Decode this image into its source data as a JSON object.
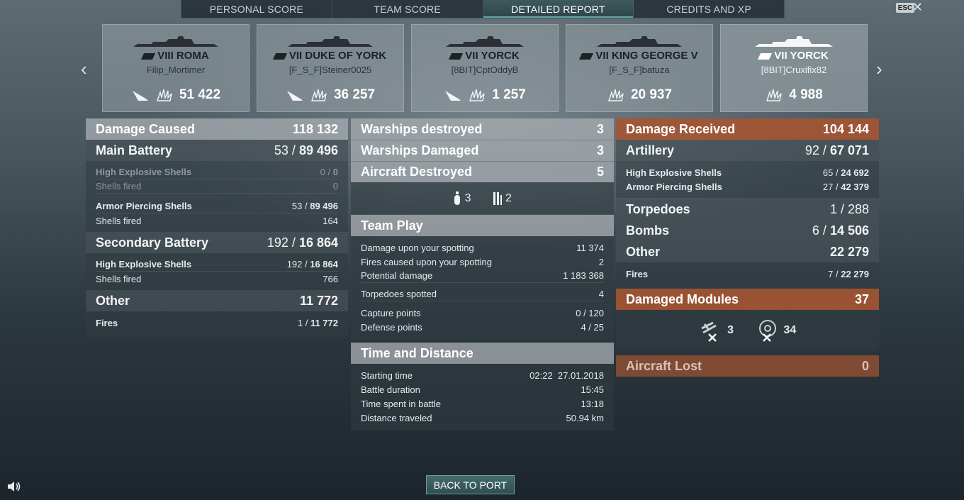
{
  "tabs": [
    "PERSONAL SCORE",
    "TEAM SCORE",
    "DETAILED REPORT",
    "CREDITS AND XP"
  ],
  "esc_label": "ESC",
  "close_glyph": "✕",
  "ships": [
    {
      "tier_name": "VIII ROMA",
      "player": "Filip_Mortimer",
      "score": "51 422"
    },
    {
      "tier_name": "VII DUKE OF YORK",
      "player": "[F_S_F]Steiner0025",
      "score": "36 257"
    },
    {
      "tier_name": "VII YORCK",
      "player": "[8BIT]CptOddyB",
      "score": "1 257"
    },
    {
      "tier_name": "VII KING GEORGE V",
      "player": "[F_S_F]batuza",
      "score": "20 937"
    },
    {
      "tier_name": "VII YORCK",
      "player": "[8BIT]Cruxifix82",
      "score": "4 988"
    }
  ],
  "left": {
    "damage_caused": {
      "label": "Damage Caused",
      "value": "118 132"
    },
    "main_battery": {
      "label": "Main Battery",
      "hits": "53 /",
      "value": "89 496"
    },
    "he_label": "High Explosive Shells",
    "he_hits": "0 /",
    "he_value": "0",
    "he_fired_label": "Shells fired",
    "he_fired": "0",
    "ap_label": "Armor Piercing Shells",
    "ap_hits": "53 /",
    "ap_value": "89 496",
    "ap_fired_label": "Shells fired",
    "ap_fired": "164",
    "secondary": {
      "label": "Secondary Battery",
      "hits": "192 /",
      "value": "16 864"
    },
    "sec_he_label": "High Explosive Shells",
    "sec_he_hits": "192 /",
    "sec_he_value": "16 864",
    "sec_fired_label": "Shells fired",
    "sec_fired": "766",
    "other": {
      "label": "Other",
      "value": "11 772"
    },
    "fires_label": "Fires",
    "fires_hits": "1 /",
    "fires_value": "11 772"
  },
  "middle": {
    "destroyed": {
      "label": "Warships destroyed",
      "value": "3"
    },
    "damaged": {
      "label": "Warships Damaged",
      "value": "3"
    },
    "aircraft": {
      "label": "Aircraft Destroyed",
      "value": "5"
    },
    "icons": {
      "a": "3",
      "b": "2"
    },
    "team_play": "Team Play",
    "tp": [
      {
        "label": "Damage upon your spotting",
        "value": "11 374"
      },
      {
        "label": "Fires caused upon your spotting",
        "value": "2"
      },
      {
        "label": "Potential damage",
        "value": "1 183 368"
      },
      {
        "label": "Torpedoes spotted",
        "value": "4"
      },
      {
        "label": "Capture points",
        "value": "0 / 120"
      },
      {
        "label": "Defense points",
        "value": "4 / 25"
      }
    ],
    "time_distance": "Time and Distance",
    "td": [
      {
        "label": "Starting time",
        "value": "02:22  27.01.2018"
      },
      {
        "label": "Battle duration",
        "value": "15:45"
      },
      {
        "label": "Time spent in battle",
        "value": "13:18"
      },
      {
        "label": "Distance traveled",
        "value": "50.94 km"
      }
    ]
  },
  "right": {
    "received": {
      "label": "Damage Received",
      "value": "104 144"
    },
    "artillery": {
      "label": "Artillery",
      "hits": "92 /",
      "value": "67 071"
    },
    "he_label": "High Explosive Shells",
    "he_hits": "65 /",
    "he_value": "24 692",
    "ap_label": "Armor Piercing Shells",
    "ap_hits": "27 /",
    "ap_value": "42 379",
    "torpedoes": {
      "label": "Torpedoes",
      "value": "1 / 288"
    },
    "bombs": {
      "label": "Bombs",
      "hits": "6 /",
      "value": "14 506"
    },
    "other": {
      "label": "Other",
      "value": "22 279"
    },
    "fires_label": "Fires",
    "fires_hits": "7 /",
    "fires_value": "22 279",
    "modules": {
      "label": "Damaged Modules",
      "value": "37"
    },
    "module_icons": {
      "a": "3",
      "b": "34"
    },
    "aircraft_lost": {
      "label": "Aircraft Lost",
      "value": "0"
    }
  },
  "back_to_port": "BACK TO PORT",
  "icons": [
    "prev-arrow-icon",
    "next-arrow-icon",
    "ship-silhouette-icon",
    "sunk-ship-icon",
    "damage-burst-icon",
    "torpedo-icon",
    "bomb-icon",
    "gun-module-icon",
    "engine-module-icon",
    "speaker-icon"
  ],
  "colors": {
    "accent_teal": "#3e5a5e",
    "received_orange": "#a55532"
  }
}
